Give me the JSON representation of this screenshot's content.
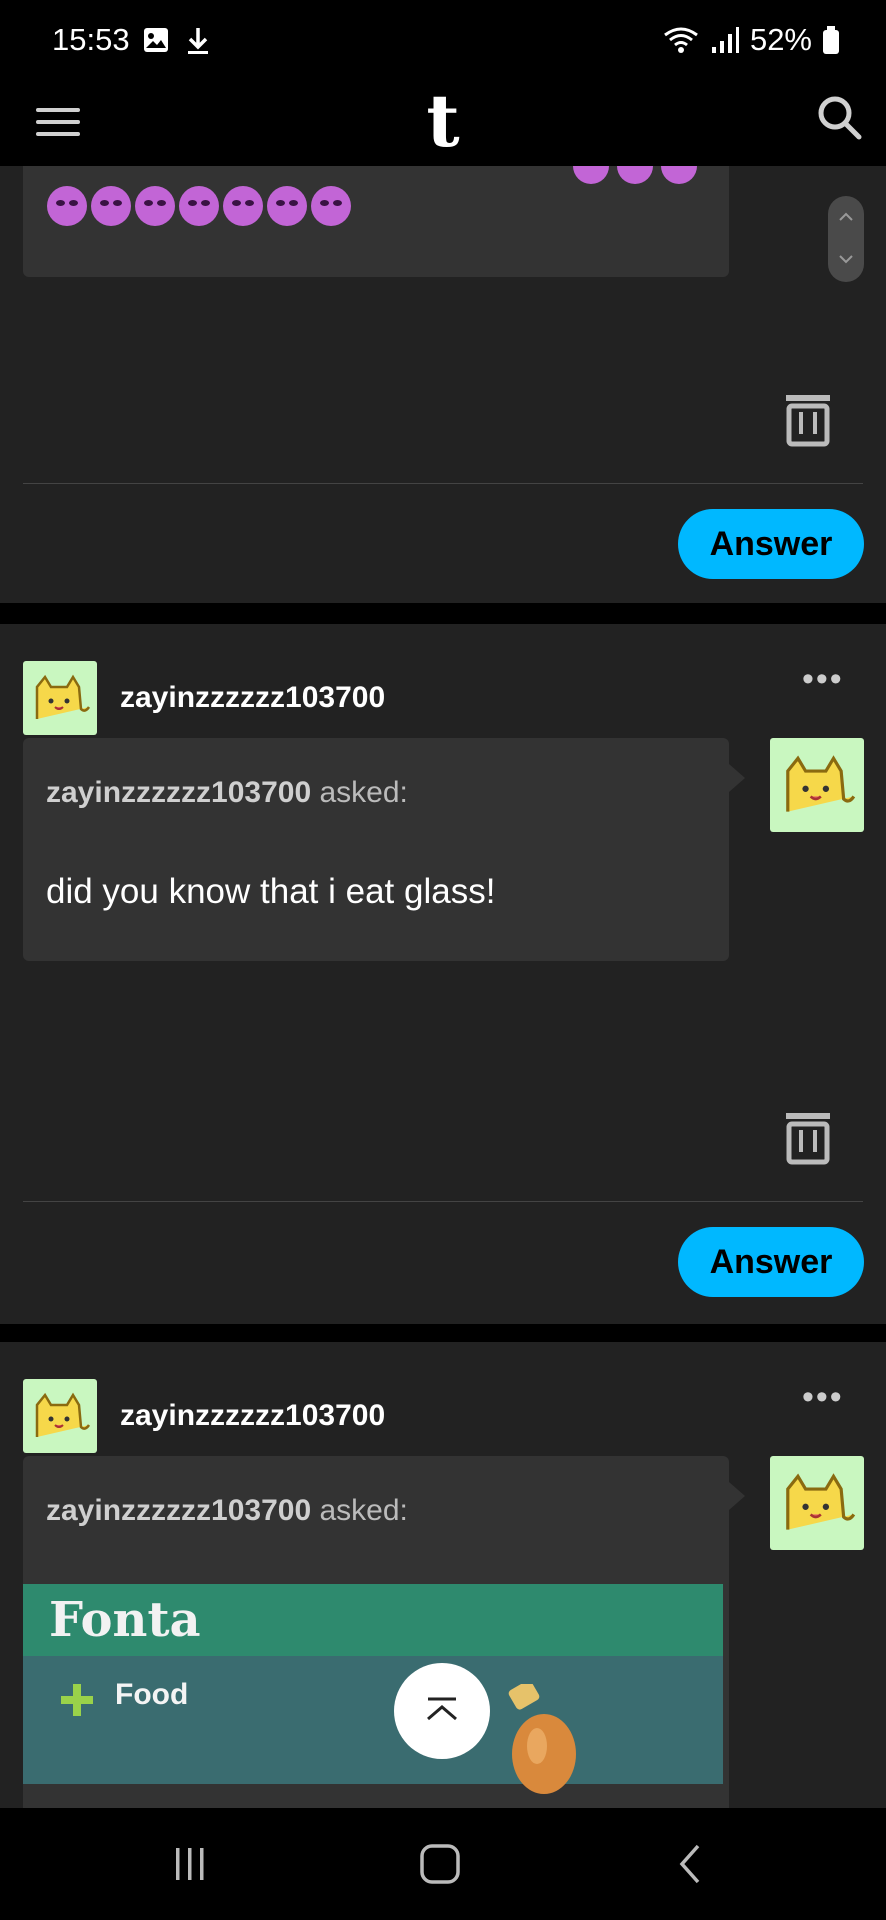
{
  "status_bar": {
    "time": "15:53",
    "battery": "52%"
  },
  "app": {
    "logo": "t"
  },
  "posts": [
    {
      "actions": {
        "answer_label": "Answer"
      }
    },
    {
      "username": "zayinzzzzzz103700",
      "asker": "zayinzzzzzz103700",
      "asked_suffix": "asked:",
      "question": "did you know that i eat glass!",
      "actions": {
        "answer_label": "Answer"
      }
    },
    {
      "username": "zayinzzzzzz103700",
      "asker": "zayinzzzzzz103700",
      "asked_suffix": "asked:",
      "image_text": {
        "title": "Fonta",
        "category": "Food"
      }
    }
  ]
}
